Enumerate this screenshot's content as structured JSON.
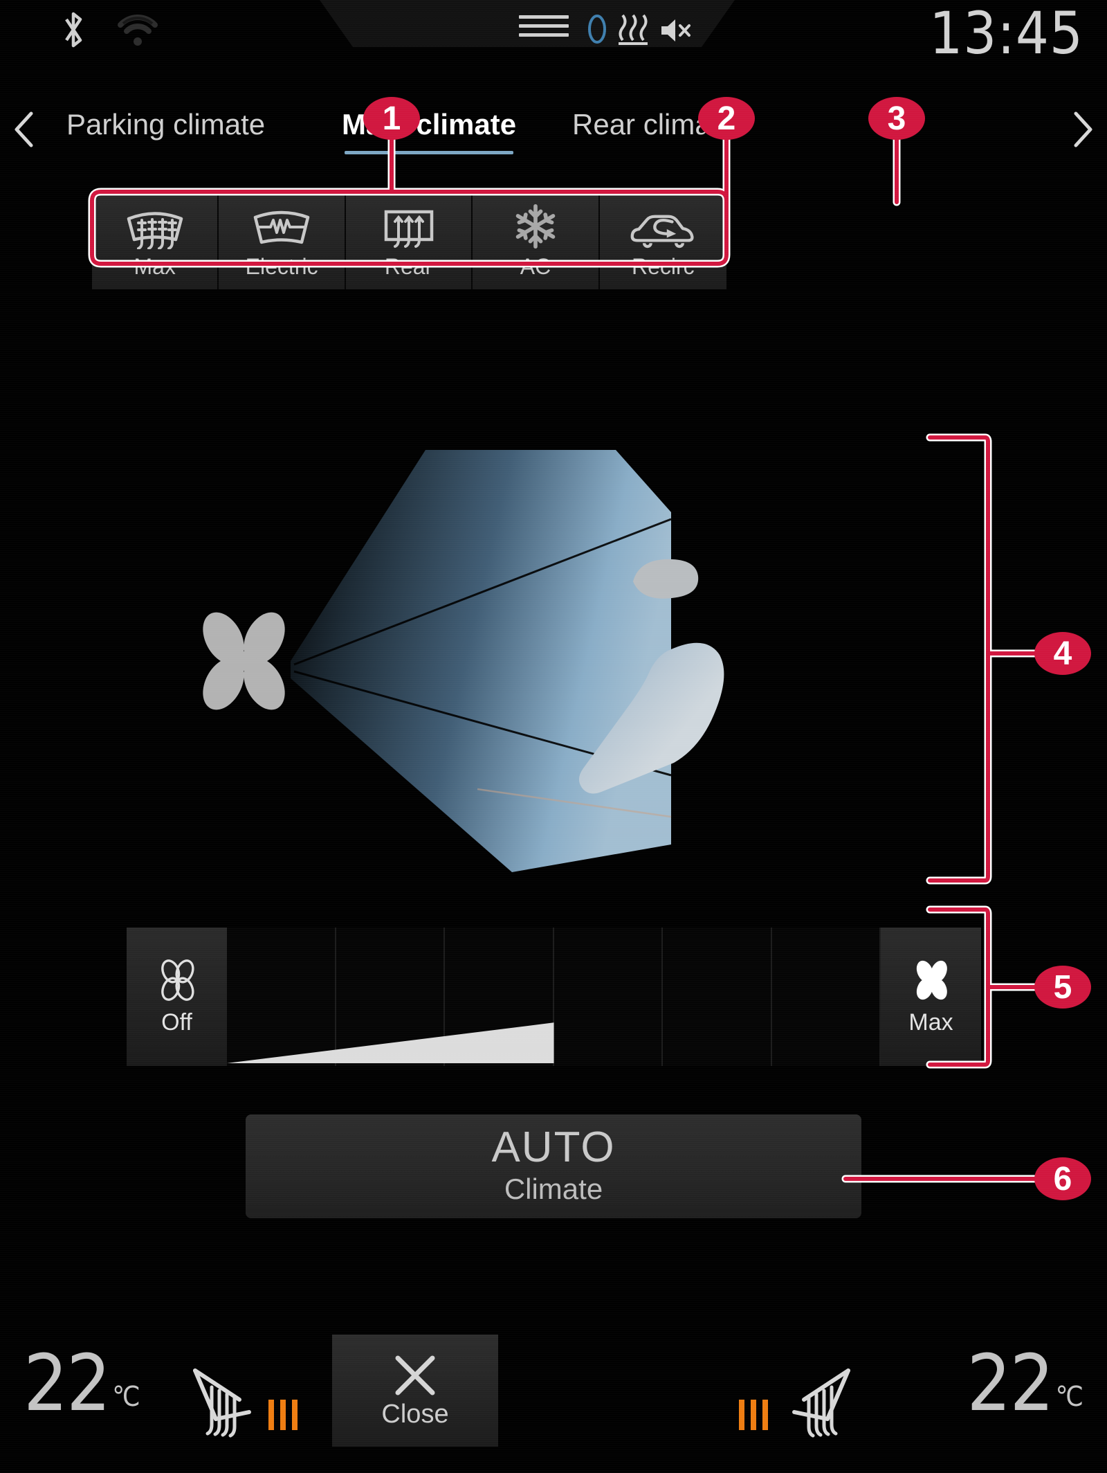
{
  "statusbar": {
    "time": "13:45",
    "icons": [
      {
        "name": "bluetooth-icon",
        "label": "Bluetooth"
      },
      {
        "name": "wifi-icon",
        "label": "Wi-Fi"
      },
      {
        "name": "menu-handle-icon",
        "label": "Menu handle"
      },
      {
        "name": "loading-circle-icon",
        "label": "Loading"
      },
      {
        "name": "heat-lines-icon",
        "label": "Heating"
      },
      {
        "name": "mute-icon",
        "label": "Sound muted"
      }
    ]
  },
  "tabs": {
    "prev_label": "‹",
    "next_label": "›",
    "items": [
      {
        "label": "Parking climate",
        "active": false
      },
      {
        "label": "Main climate",
        "active": true
      },
      {
        "label": "Rear climate",
        "active": false
      }
    ]
  },
  "function_buttons": [
    {
      "label": "Max",
      "icon": "windshield-defroster-max-icon"
    },
    {
      "label": "Electric",
      "icon": "windshield-electric-defroster-icon"
    },
    {
      "label": "Rear",
      "icon": "rear-window-defroster-icon"
    },
    {
      "label": "AC",
      "icon": "snowflake-ac-icon"
    },
    {
      "label": "Recirc",
      "icon": "air-recirculation-car-icon"
    }
  ],
  "airflow": {
    "fan_icon": "fan-blades-icon",
    "occupant_icon": "seated-person-icon",
    "description": "Airflow distribution illustration"
  },
  "fan_speed": {
    "off_label": "Off",
    "max_label": "Max",
    "off_icon": "fan-outline-icon",
    "max_icon": "fan-filled-icon",
    "segments": 6,
    "level": 3
  },
  "auto_button": {
    "title": "AUTO",
    "subtitle": "Climate"
  },
  "bottom_bar": {
    "left_temperature": "22",
    "left_unit": "℃",
    "right_temperature": "22",
    "right_unit": "℃",
    "left_seat_icon": "heated-seat-left-icon",
    "right_seat_icon": "heated-seat-right-icon",
    "left_seat_level": 3,
    "right_seat_level": 3,
    "close_label": "Close",
    "close_icon": "close-x-icon"
  },
  "callouts": {
    "accent_color": "#d1173f",
    "outline_color": "#ffffff",
    "markers": [
      {
        "id": "1",
        "target": "defroster-button-group"
      },
      {
        "id": "2",
        "target": "ac-button"
      },
      {
        "id": "3",
        "target": "recirc-button"
      },
      {
        "id": "4",
        "target": "airflow-distribution-area"
      },
      {
        "id": "5",
        "target": "fan-speed-bar"
      },
      {
        "id": "6",
        "target": "auto-climate-button"
      }
    ]
  },
  "colors": {
    "accent": "#d1173f",
    "tab_underline": "#7da7c4",
    "seat_level": "#ef7d11",
    "text": "#cfcfcf",
    "airflow_blue": "#8fb4cf"
  }
}
